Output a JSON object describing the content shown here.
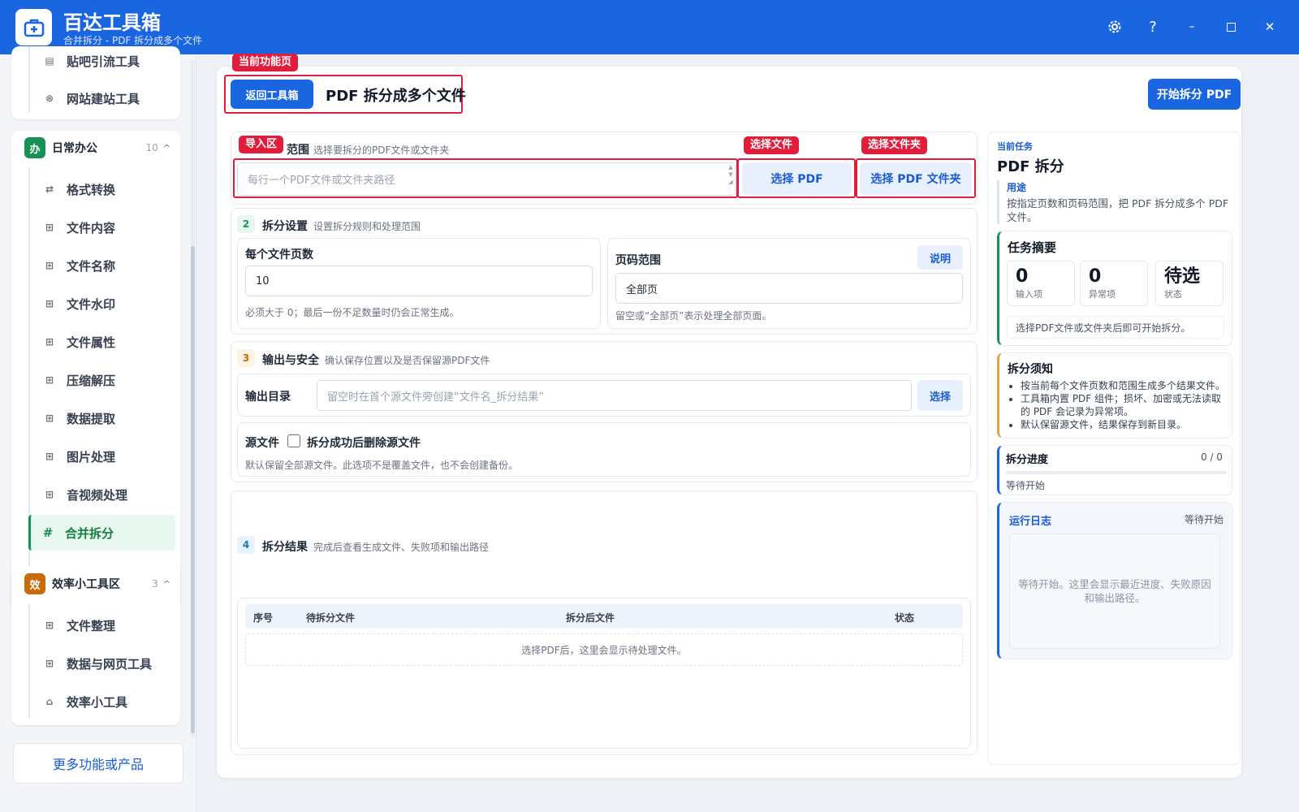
{
  "app": {
    "title": "百达工具箱",
    "subtitle": "合并拆分 - PDF 拆分成多个文件"
  },
  "window_controls": {
    "settings_icon": "gear-icon",
    "help_label": "?",
    "minimize_label": "–",
    "maximize_icon": "square-icon",
    "close_label": "✕"
  },
  "sidebar": {
    "top_items": [
      {
        "label": "贴吧引流工具",
        "icon": "doc-icon"
      },
      {
        "label": "网站建站工具",
        "icon": "globe-icon"
      }
    ],
    "groups": [
      {
        "badge": "办",
        "badge_color": "#169354",
        "name": "日常办公",
        "count": "10",
        "items": [
          {
            "label": "格式转换",
            "icon": "swap-icon"
          },
          {
            "label": "文件内容",
            "icon": "grid-icon"
          },
          {
            "label": "文件名称",
            "icon": "grid-icon"
          },
          {
            "label": "文件水印",
            "icon": "grid-icon"
          },
          {
            "label": "文件属性",
            "icon": "grid-icon"
          },
          {
            "label": "压缩解压",
            "icon": "grid-icon"
          },
          {
            "label": "数据提取",
            "icon": "grid-icon"
          },
          {
            "label": "图片处理",
            "icon": "grid-icon"
          },
          {
            "label": "音视频处理",
            "icon": "grid-icon"
          },
          {
            "label": "合并拆分",
            "icon": "hash-icon",
            "active": true
          }
        ]
      },
      {
        "badge": "效",
        "badge_color": "#c96b0a",
        "name": "效率小工具区",
        "count": "3",
        "items": [
          {
            "label": "文件整理",
            "icon": "grid-icon"
          },
          {
            "label": "数据与网页工具",
            "icon": "grid-icon"
          },
          {
            "label": "效率小工具",
            "icon": "toolbox-icon"
          }
        ]
      }
    ],
    "more_label": "更多功能或产品"
  },
  "header": {
    "tag_current": "当前功能页",
    "back_label": "返回工具箱",
    "page_title": "PDF 拆分成多个文件",
    "start_label": "开始拆分 PDF"
  },
  "import": {
    "tag": "导入区",
    "title_suffix": "范围",
    "desc": "选择要拆分的PDF文件或文件夹",
    "placeholder": "每行一个PDF文件或文件夹路径",
    "tag_file": "选择文件",
    "tag_folder": "选择文件夹",
    "btn_file": "选择 PDF",
    "btn_folder": "选择 PDF 文件夹"
  },
  "split_settings": {
    "num": "2",
    "title": "拆分设置",
    "desc": "设置拆分规则和处理范围",
    "pages_label": "每个文件页数",
    "pages_value": "10",
    "pages_hint": "必须大于 0；最后一份不足数量时仍会正常生成。",
    "range_label": "页码范围",
    "range_help": "说明",
    "range_value": "全部页",
    "range_hint": "留空或“全部页”表示处理全部页面。"
  },
  "output": {
    "num": "3",
    "title": "输出与安全",
    "desc": "确认保存位置以及是否保留源PDF文件",
    "dir_label": "输出目录",
    "dir_placeholder": "留空时在首个源文件旁创建“文件名_拆分结果”",
    "dir_button": "选择",
    "source_label": "源文件",
    "delete_label": "拆分成功后删除源文件",
    "delete_checked": false,
    "source_hint": "默认保留全部源文件。此选项不是覆盖文件，也不会创建备份。"
  },
  "results": {
    "num": "4",
    "title": "拆分结果",
    "desc": "完成后查看生成文件、失败项和输出路径",
    "columns": [
      "序号",
      "待拆分文件",
      "拆分后文件",
      "状态"
    ],
    "empty": "选择PDF后，这里会显示待处理文件。"
  },
  "task": {
    "caption": "当前任务",
    "title": "PDF 拆分",
    "usage_label": "用途",
    "usage_text": "按指定页数和页码范围，把 PDF 拆分成多个 PDF 文件。"
  },
  "summary": {
    "title": "任务摘要",
    "stats": [
      {
        "value": "0",
        "label": "输入项"
      },
      {
        "value": "0",
        "label": "异常项"
      },
      {
        "value": "待选",
        "label": "状态"
      }
    ],
    "note": "选择PDF文件或文件夹后即可开始拆分。"
  },
  "notice": {
    "title": "拆分须知",
    "items": [
      "按当前每个文件页数和范围生成多个结果文件。",
      "工具箱内置 PDF 组件；损坏、加密或无法读取的 PDF 会记录为异常项。",
      "默认保留源文件，结果保存到新目录。"
    ]
  },
  "progress": {
    "title": "拆分进度",
    "count": "0 / 0",
    "fraction": 0,
    "status": "等待开始"
  },
  "log": {
    "title": "运行日志",
    "status": "等待开始",
    "placeholder": "等待开始。这里会显示最近进度、失败原因和输出路径。"
  },
  "colors": {
    "brand": "#1a66e0",
    "accent_green": "#169354",
    "tag_red": "#e11d3c"
  }
}
